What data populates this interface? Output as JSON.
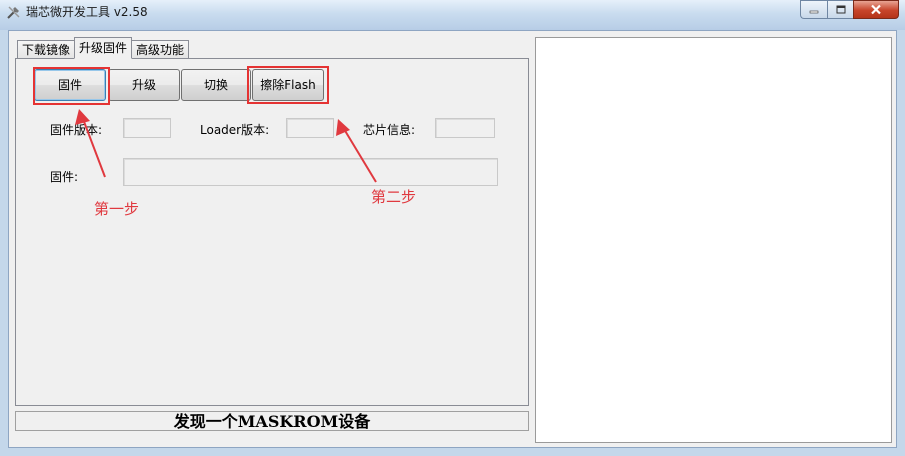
{
  "window": {
    "title": "瑞芯微开发工具 v2.58",
    "app_icon": "wrench-screwdriver-icon",
    "controls": [
      "minimize-icon",
      "maximize-icon",
      "close-icon"
    ]
  },
  "tabs": [
    {
      "label": "下载镜像",
      "active": false
    },
    {
      "label": "升级固件",
      "active": true
    },
    {
      "label": "高级功能",
      "active": false
    }
  ],
  "buttons": {
    "firmware": "固件",
    "upgrade": "升级",
    "switch": "切换",
    "erase_flash": "擦除Flash"
  },
  "info": {
    "firmware_version_label": "固件版本:",
    "firmware_version_value": "",
    "loader_version_label": "Loader版本:",
    "loader_version_value": "",
    "chip_info_label": "芯片信息:",
    "chip_info_value": "",
    "firmware_label": "固件:",
    "firmware_path_value": ""
  },
  "annotations": {
    "step1": "第一步",
    "step2": "第二步",
    "color": "#e53333"
  },
  "status": {
    "text": "发现一个MASKROM设备"
  },
  "colors": {
    "annotation_red": "#e53333",
    "focus_blue": "#3c7fb1"
  }
}
